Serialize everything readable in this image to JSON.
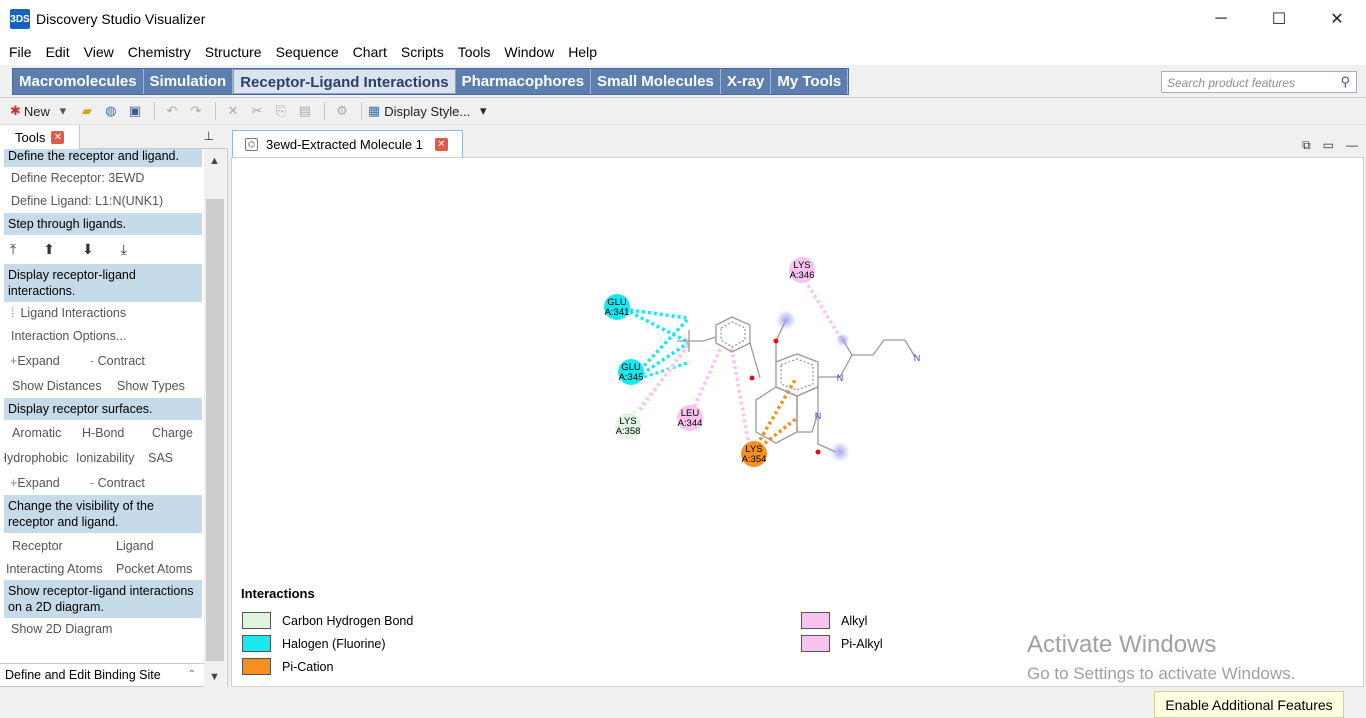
{
  "window": {
    "title": "Discovery Studio Visualizer",
    "logo": "3DS",
    "minimize": "─",
    "maximize": "☐",
    "close": "✕"
  },
  "menu": [
    "File",
    "Edit",
    "View",
    "Chemistry",
    "Structure",
    "Sequence",
    "Chart",
    "Scripts",
    "Tools",
    "Window",
    "Help"
  ],
  "tasks": {
    "tabs": [
      "Macromolecules",
      "Simulation",
      "Receptor-Ligand Interactions",
      "Pharmacophores",
      "Small Molecules",
      "X-ray",
      "My Tools"
    ],
    "active": "Receptor-Ligand Interactions",
    "search_placeholder": "Search product features"
  },
  "toolbar": {
    "new_label": "New",
    "display_style_label": "Display Style..."
  },
  "tools_panel": {
    "tab_label": "Tools",
    "sections": {
      "define": "Define the receptor and ligand.",
      "define_receptor": "Define Receptor: 3EWD",
      "define_ligand": "Define Ligand: L1:N(UNK1)",
      "step": "Step through ligands.",
      "display_interactions": "Display receptor-ligand interactions.",
      "ligand_interactions": "Ligand Interactions",
      "interaction_options": "Interaction Options...",
      "expand": "Expand",
      "contract": "Contract",
      "show_distances": "Show Distances",
      "show_types": "Show Types",
      "display_surfaces": "Display receptor surfaces.",
      "aromatic": "Aromatic",
      "hbond": "H-Bond",
      "charge": "Charge",
      "hydrophobic": "Hydrophobic",
      "ionizability": "Ionizability",
      "sas": "SAS",
      "expand2": "Expand",
      "contract2": "Contract",
      "visibility": "Change the visibility of the receptor and ligand.",
      "receptor": "Receptor",
      "ligand": "Ligand",
      "interacting_atoms": "Interacting Atoms",
      "pocket_atoms": "Pocket Atoms",
      "show_2d": "Show receptor-ligand interactions on a 2D diagram.",
      "show_2d_diagram": "Show 2D Diagram"
    },
    "footer": "Define and Edit Binding Site"
  },
  "document": {
    "tab_label": "3ewd-Extracted Molecule 1"
  },
  "diagram": {
    "residues": [
      {
        "id": "glu341",
        "line1": "GLU",
        "line2": "A:341",
        "type": "halogen"
      },
      {
        "id": "glu345",
        "line1": "GLU",
        "line2": "A:345",
        "type": "halogen"
      },
      {
        "id": "lys358",
        "line1": "LYS",
        "line2": "A:358",
        "type": "carbon-h"
      },
      {
        "id": "leu344",
        "line1": "LEU",
        "line2": "A:344",
        "type": "alkyl"
      },
      {
        "id": "lys354",
        "line1": "LYS",
        "line2": "A:354",
        "type": "pi-cation"
      },
      {
        "id": "lys346",
        "line1": "LYS",
        "line2": "A:346",
        "type": "alkyl"
      }
    ],
    "atom_labels": {
      "n1": "N",
      "n2": "N",
      "n3": "N"
    }
  },
  "legend": {
    "title": "Interactions",
    "items": [
      {
        "label": "Carbon Hydrogen Bond",
        "color": "#dff5e0"
      },
      {
        "label": "Halogen (Fluorine)",
        "color": "#19e8f0"
      },
      {
        "label": "Pi-Cation",
        "color": "#f58f1f"
      },
      {
        "label": "Alkyl",
        "color": "#f7c4f0"
      },
      {
        "label": "Pi-Alkyl",
        "color": "#f7c4f0"
      }
    ]
  },
  "watermark": {
    "line1": "Activate Windows",
    "line2": "Go to Settings to activate Windows."
  },
  "status": {
    "enable_features": "Enable Additional Features"
  }
}
